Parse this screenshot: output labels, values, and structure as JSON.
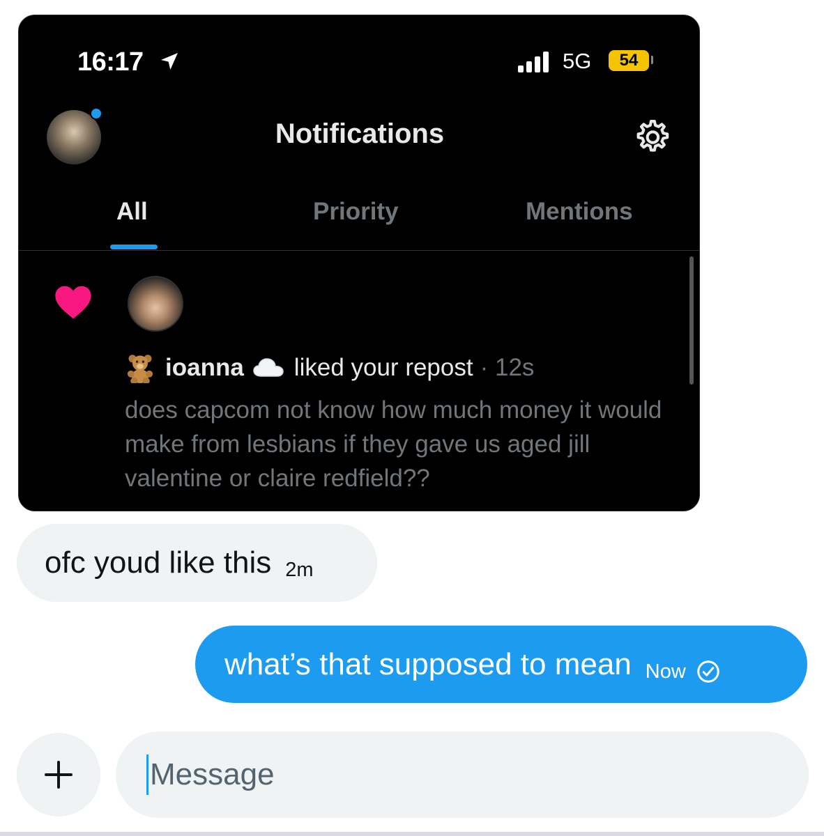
{
  "status_bar": {
    "time": "16:17",
    "network": "5G",
    "battery": "54"
  },
  "header": {
    "title": "Notifications"
  },
  "tabs": [
    {
      "label": "All",
      "active": true
    },
    {
      "label": "Priority",
      "active": false
    },
    {
      "label": "Mentions",
      "active": false
    }
  ],
  "notification": {
    "user_name": "ioanna",
    "action": "liked your repost",
    "time": "· 12s",
    "post_text": "does capcom not know how much money it would make from lesbians if they gave us aged jill valentine or claire redfield??"
  },
  "messages": {
    "incoming": {
      "text": "ofc youd like this",
      "time": "2m"
    },
    "outgoing": {
      "text": "what’s that supposed to mean",
      "time": "Now"
    }
  },
  "composer": {
    "placeholder": "Message"
  },
  "colors": {
    "accent": "#1d9bf0",
    "like": "#f91880",
    "battery": "#f5c400"
  },
  "icons": [
    "location-arrow-icon",
    "signal-bars-icon",
    "gear-icon",
    "heart-icon",
    "teddy-bear-icon",
    "cloud-icon",
    "check-circle-icon",
    "plus-icon"
  ]
}
